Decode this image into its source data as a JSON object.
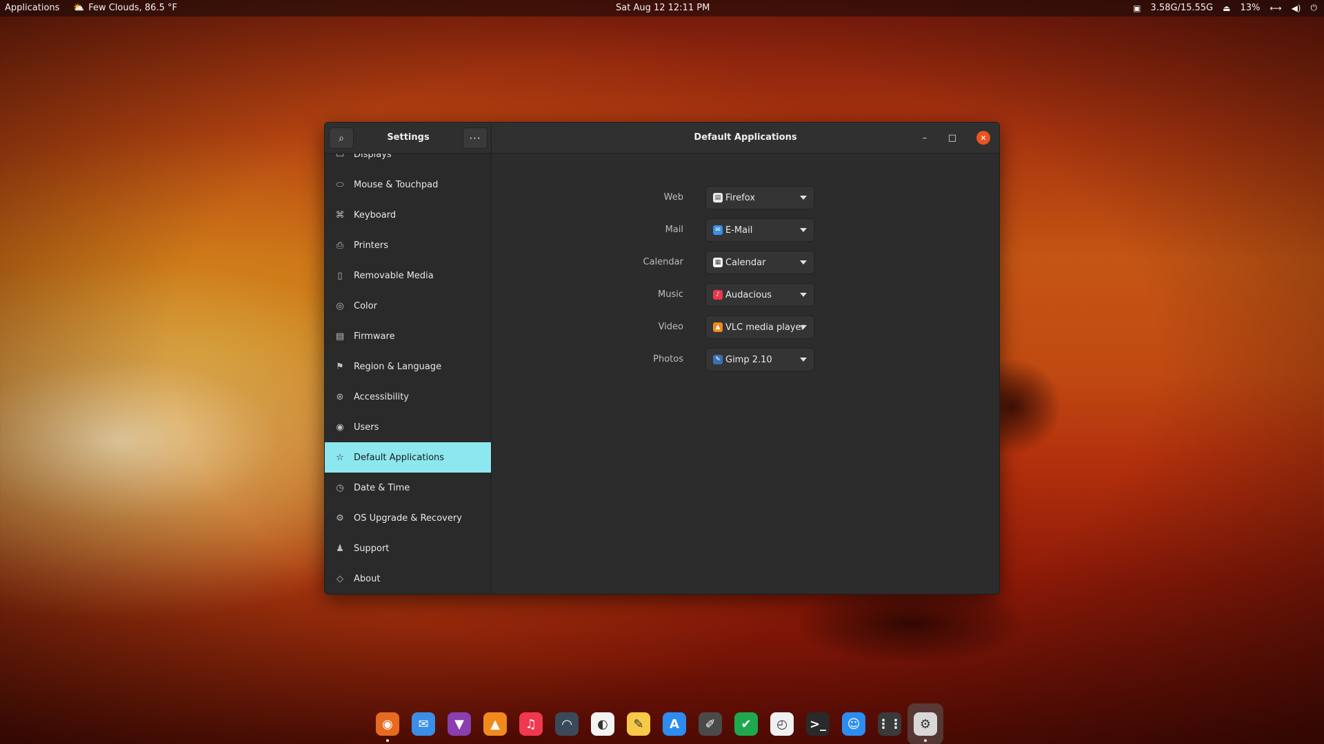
{
  "topbar": {
    "applications": "Applications",
    "weather": "Few Clouds, 86.5 °F",
    "clock": "Sat Aug 12  12:11 PM",
    "memory": "3.58G/15.55G",
    "battery": "13%"
  },
  "window": {
    "sidebar_title": "Settings",
    "title": "Default Applications",
    "menu_glyph": "···",
    "min_glyph": "–",
    "max_glyph": "□",
    "close_glyph": "✕"
  },
  "sidebar": {
    "items": [
      {
        "label": "Displays",
        "icon": "displays-icon",
        "glyph": "▭"
      },
      {
        "label": "Mouse & Touchpad",
        "icon": "mouse-icon",
        "glyph": "⬭"
      },
      {
        "label": "Keyboard",
        "icon": "keyboard-icon",
        "glyph": "⌘"
      },
      {
        "label": "Printers",
        "icon": "printer-icon",
        "glyph": "⎙"
      },
      {
        "label": "Removable Media",
        "icon": "removable-media-icon",
        "glyph": "▯"
      },
      {
        "label": "Color",
        "icon": "color-icon",
        "glyph": "◎"
      },
      {
        "label": "Firmware",
        "icon": "firmware-icon",
        "glyph": "▤"
      },
      {
        "label": "Region & Language",
        "icon": "region-language-icon",
        "glyph": "⚑"
      },
      {
        "label": "Accessibility",
        "icon": "accessibility-icon",
        "glyph": "⊛"
      },
      {
        "label": "Users",
        "icon": "users-icon",
        "glyph": "◉"
      },
      {
        "label": "Default Applications",
        "icon": "star-icon",
        "glyph": "☆"
      },
      {
        "label": "Date & Time",
        "icon": "clock-icon",
        "glyph": "◷"
      },
      {
        "label": "OS Upgrade & Recovery",
        "icon": "upgrade-icon",
        "glyph": "⚙"
      },
      {
        "label": "Support",
        "icon": "support-icon",
        "glyph": "♟"
      },
      {
        "label": "About",
        "icon": "about-icon",
        "glyph": "◇"
      }
    ],
    "selected_index": 10
  },
  "defaults": [
    {
      "label": "Web",
      "app": "Firefox",
      "icon": "firefox-file-icon",
      "color": "#e8e8e8",
      "glyph": "▤"
    },
    {
      "label": "Mail",
      "app": "E-Mail",
      "icon": "email-app-icon",
      "color": "#3a8ee6",
      "glyph": "✉"
    },
    {
      "label": "Calendar",
      "app": "Calendar",
      "icon": "calendar-app-icon",
      "color": "#f2f2f2",
      "glyph": "▦"
    },
    {
      "label": "Music",
      "app": "Audacious",
      "icon": "audacious-app-icon",
      "color": "#e8384f",
      "glyph": "♪"
    },
    {
      "label": "Video",
      "app": "VLC media player",
      "icon": "vlc-app-icon",
      "color": "#f08a1c",
      "glyph": "▲"
    },
    {
      "label": "Photos",
      "app": "Gimp 2.10",
      "icon": "gimp-app-icon",
      "color": "#3b6fb6",
      "glyph": "✎"
    }
  ],
  "dock": {
    "items": [
      {
        "name": "firefox",
        "color": "#e66a1f",
        "glyph": "◉",
        "running": true
      },
      {
        "name": "mail",
        "color": "#3a8ee6",
        "glyph": "✉",
        "running": false
      },
      {
        "name": "brave",
        "color": "#8a3fb0",
        "glyph": "▼",
        "running": false
      },
      {
        "name": "vlc",
        "color": "#f08a1c",
        "glyph": "▲",
        "running": false
      },
      {
        "name": "music",
        "color": "#f0384f",
        "glyph": "♫",
        "running": false
      },
      {
        "name": "audio-player",
        "color": "#3a4a5a",
        "glyph": "◠",
        "running": false
      },
      {
        "name": "image-viewer",
        "color": "#f4f4f4",
        "glyph": "◐",
        "running": false
      },
      {
        "name": "notes",
        "color": "#f7c948",
        "glyph": "✎",
        "running": false
      },
      {
        "name": "app-store",
        "color": "#2d8cf0",
        "glyph": "A",
        "running": false
      },
      {
        "name": "text-editor",
        "color": "#4a4a4a",
        "glyph": "✐",
        "running": false
      },
      {
        "name": "security",
        "color": "#1fa84f",
        "glyph": "✔",
        "running": false
      },
      {
        "name": "clock",
        "color": "#f0f0f0",
        "glyph": "◴",
        "running": false
      },
      {
        "name": "terminal",
        "color": "#2a2a2a",
        "glyph": ">_",
        "running": false
      },
      {
        "name": "finder",
        "color": "#2d8cf0",
        "glyph": "☺",
        "running": false
      },
      {
        "name": "app-grid",
        "color": "#3a3a3a",
        "glyph": "⋮⋮",
        "running": false
      },
      {
        "name": "settings",
        "color": "#d8d8d8",
        "glyph": "⚙",
        "running": true,
        "active": true
      }
    ]
  }
}
